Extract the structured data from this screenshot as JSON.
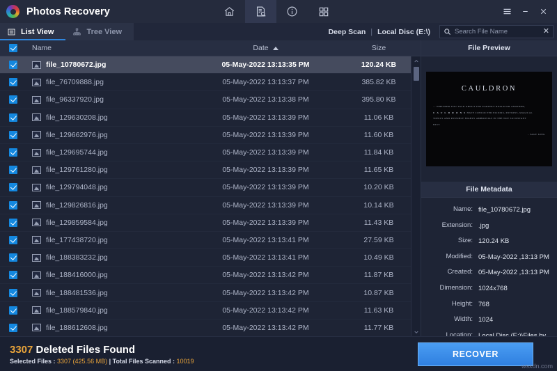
{
  "window": {
    "title": "Photos Recovery",
    "logo_icon": "photos-recovery-logo",
    "nav_icons": [
      {
        "name": "home-icon",
        "active": false
      },
      {
        "name": "document-search-icon",
        "active": true
      },
      {
        "name": "info-icon",
        "active": false
      },
      {
        "name": "grid-icon",
        "active": false
      }
    ],
    "controls": [
      {
        "name": "menu-icon",
        "glyph": "☰"
      },
      {
        "name": "minimize-icon",
        "glyph": "–"
      },
      {
        "name": "close-icon",
        "glyph": "✕"
      }
    ]
  },
  "toolbar": {
    "tabs": [
      {
        "label": "List View",
        "icon": "list-view-icon",
        "active": true
      },
      {
        "label": "Tree View",
        "icon": "tree-view-icon",
        "active": false
      }
    ],
    "scan_mode": "Deep Scan",
    "separator": "|",
    "drive": "Local Disc (E:\\)",
    "search": {
      "icon": "search-icon",
      "placeholder": "Search File Name",
      "value": "",
      "clear_icon": "close-icon",
      "clear_glyph": "✕"
    }
  },
  "table": {
    "columns": {
      "checkbox": "select-all",
      "name": "Name",
      "date": "Date",
      "size": "Size"
    },
    "sort": {
      "column": "Date",
      "direction": "asc"
    },
    "rows": [
      {
        "name": "file_10780672.jpg",
        "date": "05-May-2022 13:13:35 PM",
        "size": "120.24 KB",
        "checked": true,
        "selected": true
      },
      {
        "name": "file_76709888.jpg",
        "date": "05-May-2022 13:13:37 PM",
        "size": "385.82 KB",
        "checked": true,
        "selected": false
      },
      {
        "name": "file_96337920.jpg",
        "date": "05-May-2022 13:13:38 PM",
        "size": "395.80 KB",
        "checked": true,
        "selected": false
      },
      {
        "name": "file_129630208.jpg",
        "date": "05-May-2022 13:13:39 PM",
        "size": "11.06 KB",
        "checked": true,
        "selected": false
      },
      {
        "name": "file_129662976.jpg",
        "date": "05-May-2022 13:13:39 PM",
        "size": "11.60 KB",
        "checked": true,
        "selected": false
      },
      {
        "name": "file_129695744.jpg",
        "date": "05-May-2022 13:13:39 PM",
        "size": "11.84 KB",
        "checked": true,
        "selected": false
      },
      {
        "name": "file_129761280.jpg",
        "date": "05-May-2022 13:13:39 PM",
        "size": "11.65 KB",
        "checked": true,
        "selected": false
      },
      {
        "name": "file_129794048.jpg",
        "date": "05-May-2022 13:13:39 PM",
        "size": "10.20 KB",
        "checked": true,
        "selected": false
      },
      {
        "name": "file_129826816.jpg",
        "date": "05-May-2022 13:13:39 PM",
        "size": "10.14 KB",
        "checked": true,
        "selected": false
      },
      {
        "name": "file_129859584.jpg",
        "date": "05-May-2022 13:13:39 PM",
        "size": "11.43 KB",
        "checked": true,
        "selected": false
      },
      {
        "name": "file_177438720.jpg",
        "date": "05-May-2022 13:13:41 PM",
        "size": "27.59 KB",
        "checked": true,
        "selected": false
      },
      {
        "name": "file_188383232.jpg",
        "date": "05-May-2022 13:13:41 PM",
        "size": "10.49 KB",
        "checked": true,
        "selected": false
      },
      {
        "name": "file_188416000.jpg",
        "date": "05-May-2022 13:13:42 PM",
        "size": "11.87 KB",
        "checked": true,
        "selected": false
      },
      {
        "name": "file_188481536.jpg",
        "date": "05-May-2022 13:13:42 PM",
        "size": "10.87 KB",
        "checked": true,
        "selected": false
      },
      {
        "name": "file_188579840.jpg",
        "date": "05-May-2022 13:13:42 PM",
        "size": "11.63 KB",
        "checked": true,
        "selected": false
      },
      {
        "name": "file_188612608.jpg",
        "date": "05-May-2022 13:13:42 PM",
        "size": "11.77 KB",
        "checked": true,
        "selected": false
      }
    ]
  },
  "preview": {
    "title": "File Preview",
    "image": {
      "heading": "CAULDRON",
      "body_line1": "... WHETHER YOU TALK ABOUT THE EARTHLY REALM OR ANOTHER,",
      "body_brand": "C A U L D R O N S",
      "body_line2": "HAVE CONCOCTED ELIXIRS, POTIONS, MAGICAL",
      "body_line3": "TONICS AND POSSIBLY HIGHLY AMBROSIAS IN THE NOT SO DISTANT",
      "body_line4": "PAST.",
      "signature": "- SAGE KING"
    }
  },
  "metadata": {
    "title": "File Metadata",
    "fields": [
      {
        "label": "Name:",
        "value": "file_10780672.jpg"
      },
      {
        "label": "Extension:",
        "value": ".jpg"
      },
      {
        "label": "Size:",
        "value": "120.24 KB"
      },
      {
        "label": "Modified:",
        "value": "05-May-2022 ,13:13 PM"
      },
      {
        "label": "Created:",
        "value": "05-May-2022 ,13:13 PM"
      },
      {
        "label": "Dimension:",
        "value": "1024x768"
      },
      {
        "label": "Height:",
        "value": "768"
      },
      {
        "label": "Width:",
        "value": "1024"
      },
      {
        "label": "Location:",
        "value": "Local Disc (E:)\\Files by content\\.jpg"
      }
    ]
  },
  "footer": {
    "found_count": "3307",
    "found_text": "Deleted Files Found",
    "selected_prefix": "Selected Files : ",
    "selected_value": "3307 (425.56 MB)",
    "mid_separator": " | ",
    "scanned_prefix": "Total Files Scanned : ",
    "scanned_value": "10019",
    "recover_label": "RECOVER",
    "watermark": "wsxdn.com"
  },
  "colors": {
    "accent_blue": "#2f86de",
    "checkbox_blue": "#1488e0",
    "amber": "#e8a33a",
    "bg_dark": "#1e2435",
    "bg_titlebar": "#252b3d",
    "row_selected": "#454b5e"
  }
}
